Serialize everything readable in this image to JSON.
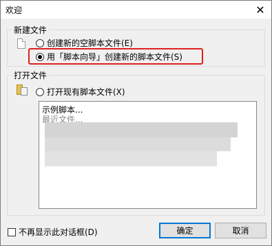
{
  "window": {
    "title": "欢迎",
    "close_glyph": "✕"
  },
  "new_file": {
    "group_label": "新建文件",
    "option_empty": "创建新的空脚本文件(E)",
    "option_wizard": "用「脚本向导」创建新的脚本文件(S)",
    "selected": "option_wizard"
  },
  "open_file": {
    "group_label": "打开文件",
    "option_open": "打开现有脚本文件(X)",
    "list_items": [
      "示例脚本...",
      "最近文件..."
    ]
  },
  "footer": {
    "dont_show_label": "不再显示此对话框(D)",
    "dont_show_checked": false,
    "ok_label": "确定",
    "cancel_label": "取消"
  },
  "colors": {
    "highlight_border": "#e0201a",
    "default_button_border": "#0078d7"
  }
}
